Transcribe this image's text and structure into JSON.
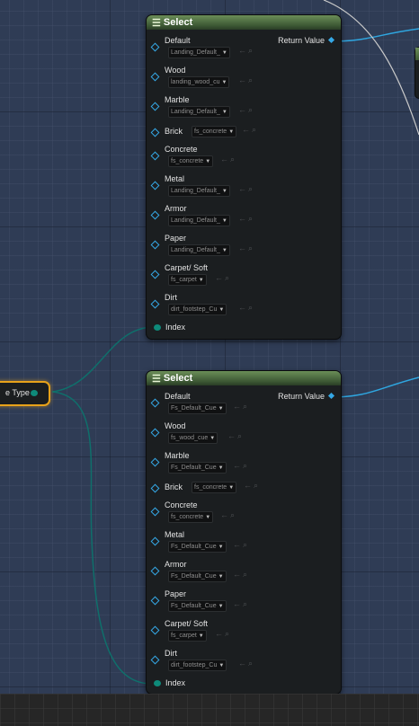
{
  "source_node": {
    "label": "e Type"
  },
  "nodes": [
    {
      "title": "Select",
      "return_label": "Return Value",
      "index_label": "Index",
      "options": [
        {
          "label": "Default",
          "value": "Landing_Default_"
        },
        {
          "label": "Wood",
          "value": "landing_wood_cu"
        },
        {
          "label": "Marble",
          "value": "Landing_Default_"
        },
        {
          "label": "Brick",
          "value": "fs_concrete"
        },
        {
          "label": "Concrete",
          "value": "fs_concrete"
        },
        {
          "label": "Metal",
          "value": "Landing_Default_"
        },
        {
          "label": "Armor",
          "value": "Landing_Default_"
        },
        {
          "label": "Paper",
          "value": "Landing_Default_"
        },
        {
          "label": "Carpet/ Soft",
          "value": "fs_carpet"
        },
        {
          "label": "Dirt",
          "value": "dirt_footstep_Cu"
        }
      ]
    },
    {
      "title": "Select",
      "return_label": "Return Value",
      "index_label": "Index",
      "options": [
        {
          "label": "Default",
          "value": "Fs_Default_Cue"
        },
        {
          "label": "Wood",
          "value": "fs_wood_cue"
        },
        {
          "label": "Marble",
          "value": "Fs_Default_Cue"
        },
        {
          "label": "Brick",
          "value": "fs_concrete"
        },
        {
          "label": "Concrete",
          "value": "fs_concrete"
        },
        {
          "label": "Metal",
          "value": "Fs_Default_Cue"
        },
        {
          "label": "Armor",
          "value": "Fs_Default_Cue"
        },
        {
          "label": "Paper",
          "value": "Fs_Default_Cue"
        },
        {
          "label": "Carpet/ Soft",
          "value": "fs_carpet"
        },
        {
          "label": "Dirt",
          "value": "dirt_footstep_Cu"
        }
      ]
    }
  ],
  "icons": {
    "header": "select-node-icon",
    "use": "use-selected-asset-icon",
    "browse": "browse-asset-icon",
    "dropdown": "chevron-down-icon"
  },
  "colors": {
    "header_green": "#5b7d4a",
    "pin_blue": "#35a8e6",
    "exec_teal": "#0e8a7a",
    "selected_orange": "#e8a21a",
    "wire_teal": "#0f6f6b"
  }
}
